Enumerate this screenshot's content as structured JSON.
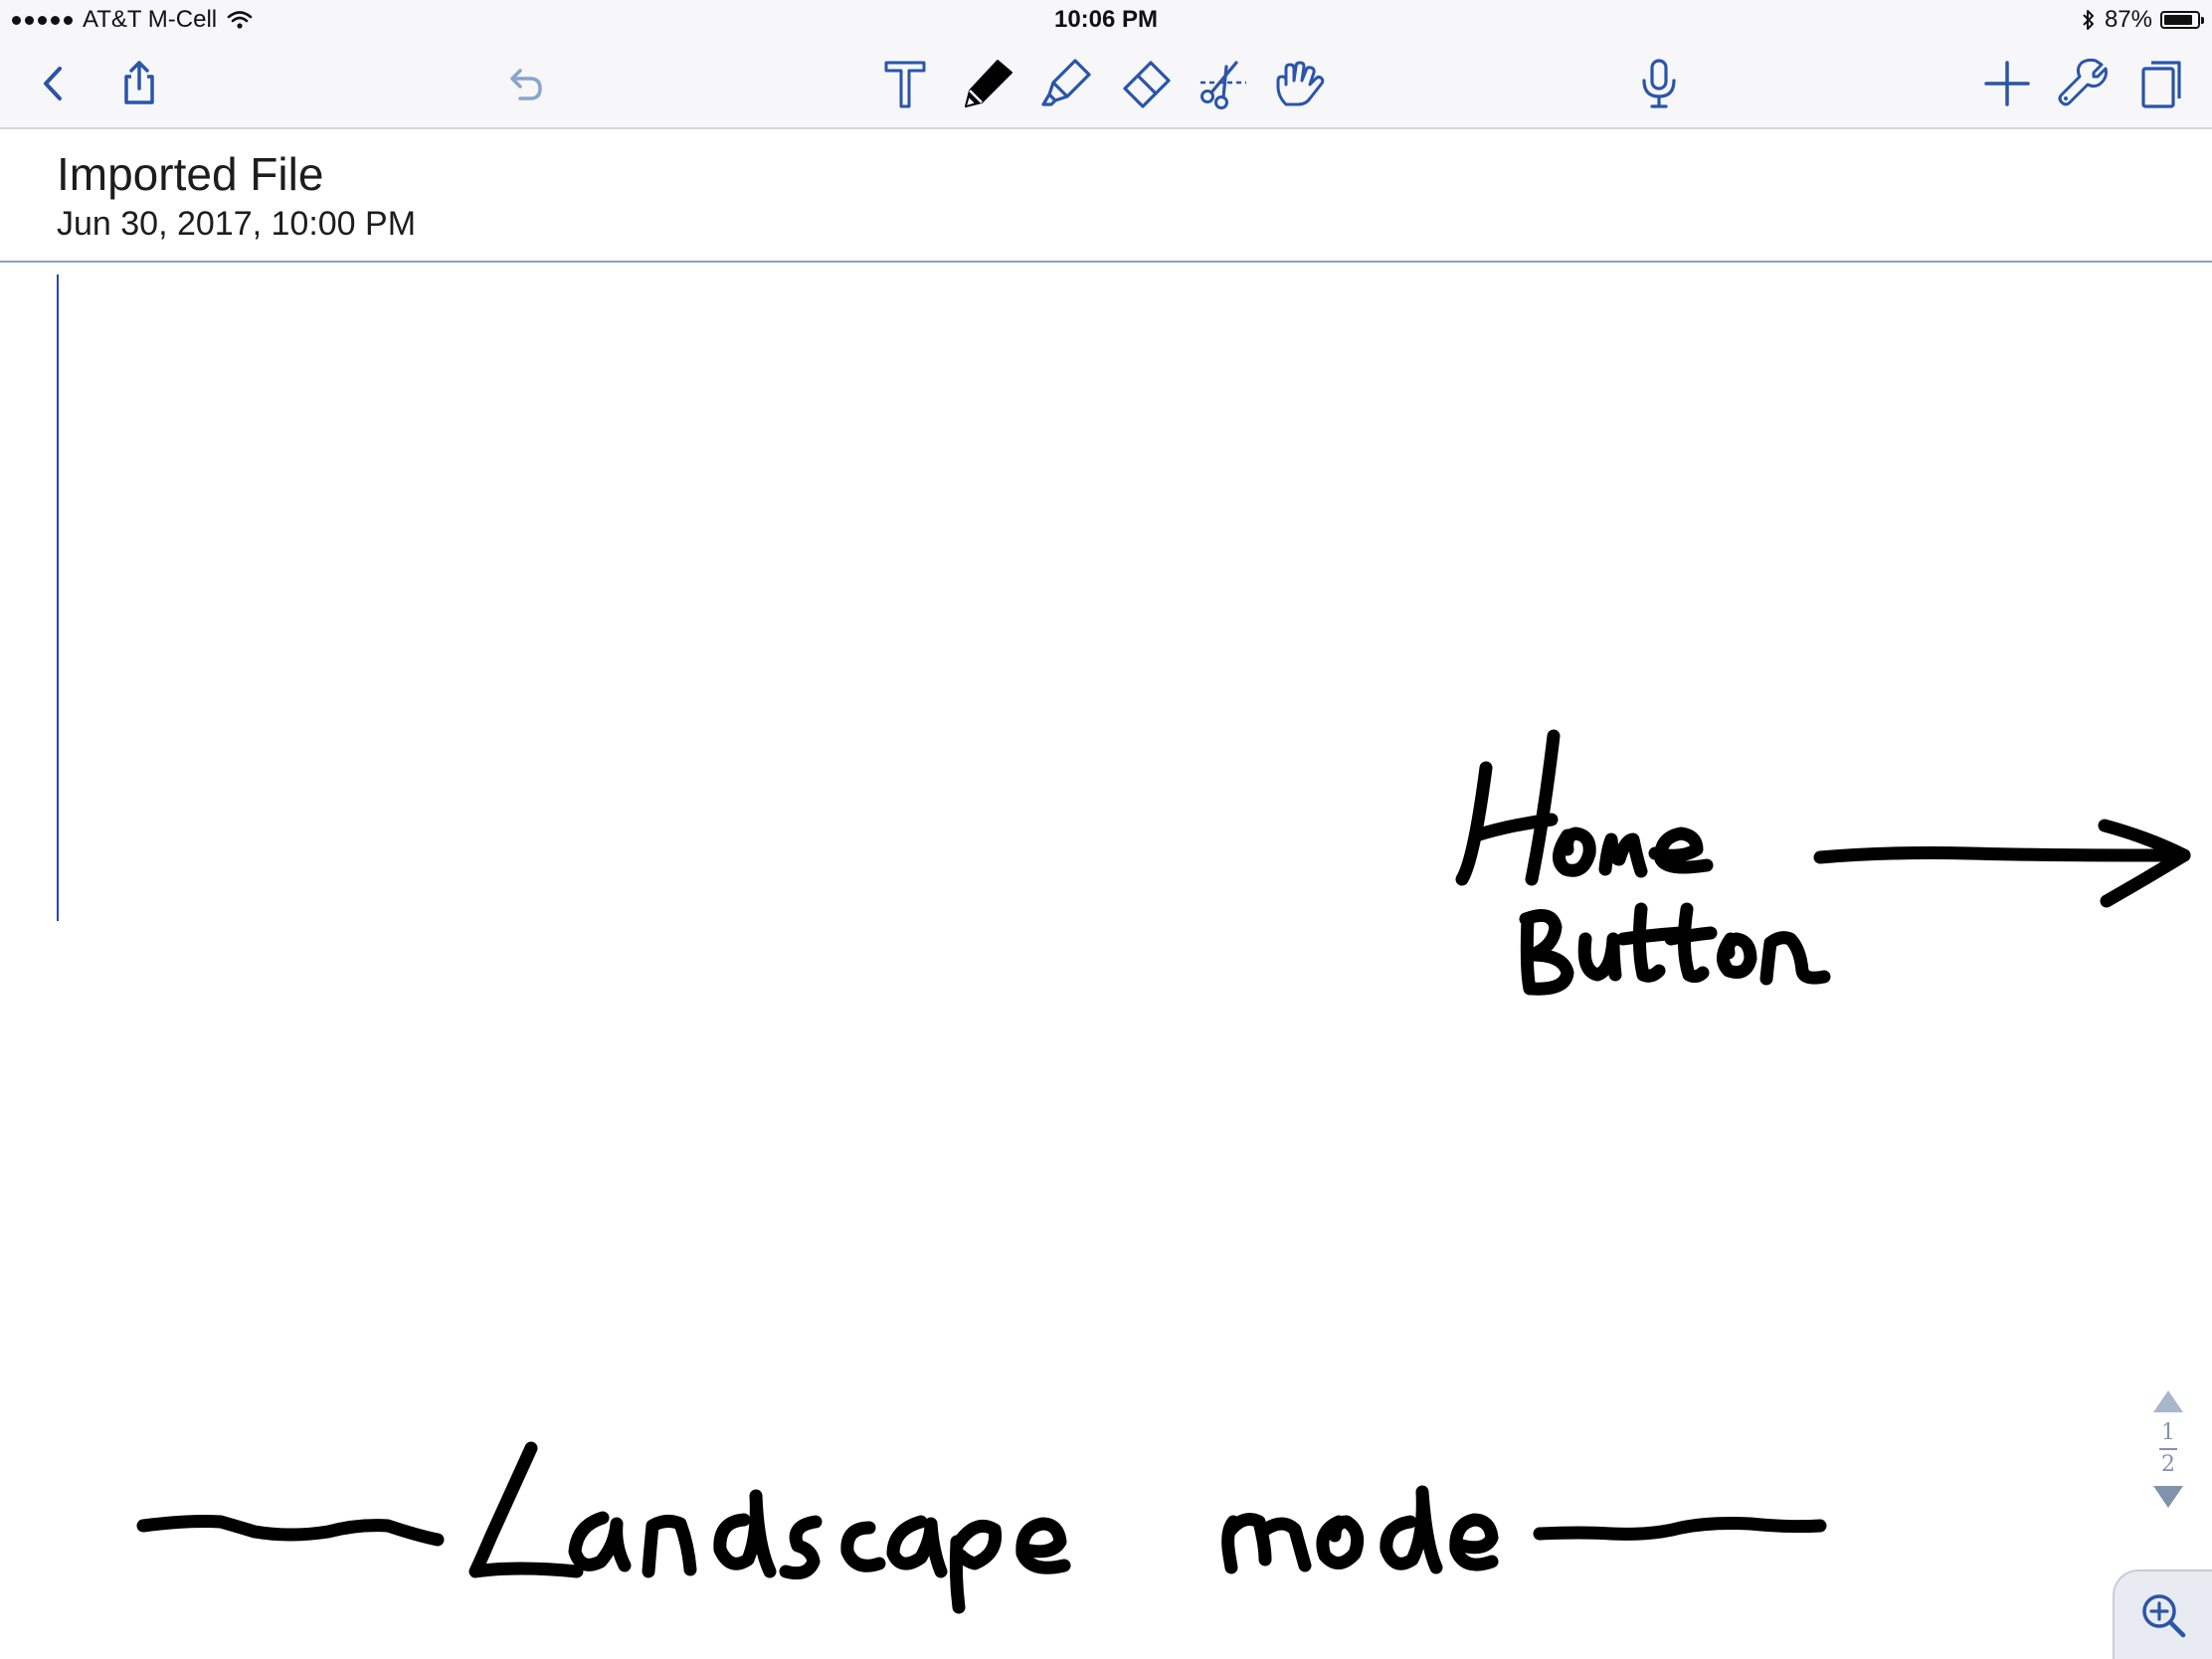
{
  "status_bar": {
    "carrier": "AT&T M-Cell",
    "time": "10:06 PM",
    "battery": "87%",
    "battery_level": 0.87
  },
  "toolbar": {
    "left": [
      {
        "name": "back",
        "icon": "chevron-left-icon"
      },
      {
        "name": "share",
        "icon": "share-icon"
      },
      {
        "name": "undo",
        "icon": "undo-icon"
      }
    ],
    "center": [
      {
        "name": "text-tool",
        "icon": "text-icon"
      },
      {
        "name": "pen-tool",
        "icon": "pen-icon",
        "selected": true
      },
      {
        "name": "highlighter-tool",
        "icon": "highlighter-icon"
      },
      {
        "name": "eraser-tool",
        "icon": "eraser-icon"
      },
      {
        "name": "lasso-tool",
        "icon": "scissors-icon"
      },
      {
        "name": "hand-tool",
        "icon": "hand-icon"
      }
    ],
    "right": [
      {
        "name": "microphone",
        "icon": "microphone-icon"
      },
      {
        "name": "add",
        "icon": "plus-icon"
      },
      {
        "name": "settings",
        "icon": "wrench-icon"
      },
      {
        "name": "pages",
        "icon": "pages-icon"
      }
    ],
    "accent_color": "#2a55a8",
    "disabled_color": "#8aa3cc"
  },
  "note": {
    "title": "Imported File",
    "date": "Jun 30, 2017, 10:00 PM"
  },
  "handwriting": {
    "ink_color": "#000000",
    "words": [
      "Home",
      "Button",
      "Landscape",
      "mode"
    ]
  },
  "page_nav": {
    "current": "1",
    "total": "2"
  },
  "colors": {
    "background": "#ffffff",
    "bar_background": "#f7f7f9",
    "margin_line": "#2a44b5"
  }
}
